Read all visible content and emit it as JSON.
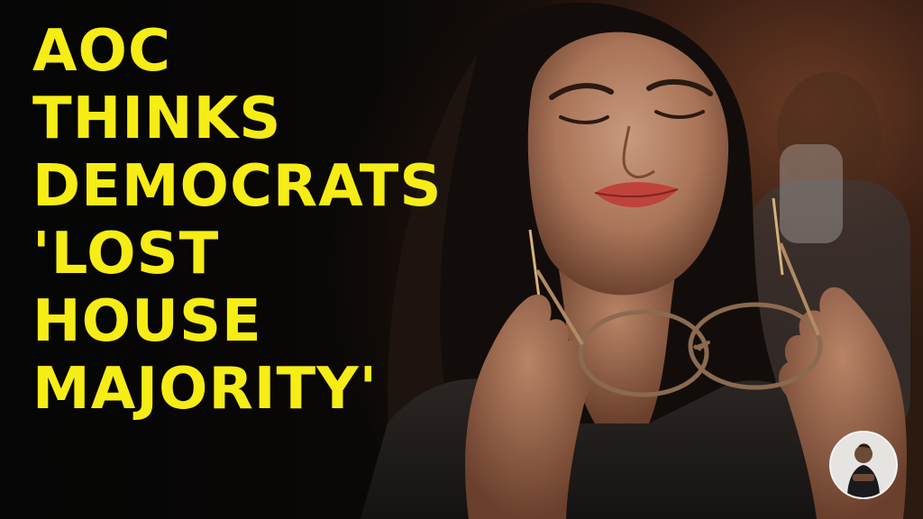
{
  "headline": {
    "lines": [
      "AOC",
      "THINKS",
      "DEMOCRATS",
      "'LOST",
      "HOUSE",
      "MAJORITY'"
    ],
    "color": "#f6ec16"
  },
  "background_color": "#0b0b0b",
  "photo": {
    "subject": "woman-holding-glasses-photo"
  },
  "channel_avatar": {
    "icon": "channel-avatar-icon"
  }
}
